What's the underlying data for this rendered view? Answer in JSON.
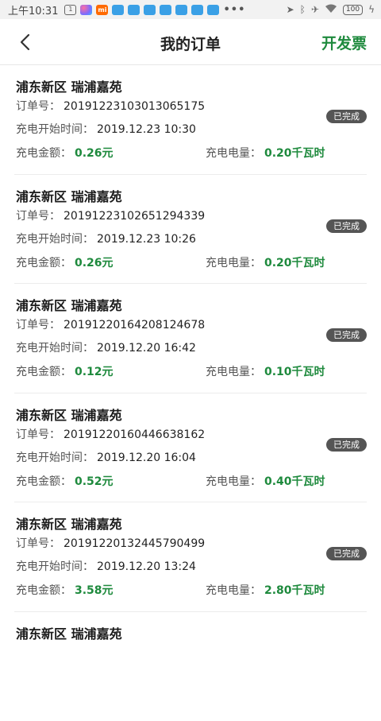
{
  "status_bar": {
    "time": "上午10:31",
    "notification_icons": [
      "box-icon",
      "colorful-app-icon",
      "mi-icon",
      "cloud-icon",
      "cloud-icon",
      "cloud-icon",
      "cloud-icon",
      "cloud-icon",
      "cloud-icon",
      "cloud-icon"
    ],
    "mi_label": "mi",
    "box_label": "1",
    "more": "•••",
    "battery": "100"
  },
  "header": {
    "title": "我的订单",
    "action_label": "开发票"
  },
  "labels": {
    "order_no": "订单号：",
    "start_time": "充电开始时间：",
    "amount": "充电金额：",
    "energy": "充电电量："
  },
  "orders": [
    {
      "station": "浦东新区 瑞浦嘉苑",
      "order_no": "20191223103013065175",
      "start_time": "2019.12.23 10:30",
      "amount": "0.26元",
      "energy": "0.20千瓦时",
      "status": "已完成"
    },
    {
      "station": "浦东新区 瑞浦嘉苑",
      "order_no": "20191223102651294339",
      "start_time": "2019.12.23 10:26",
      "amount": "0.26元",
      "energy": "0.20千瓦时",
      "status": "已完成"
    },
    {
      "station": "浦东新区 瑞浦嘉苑",
      "order_no": "20191220164208124678",
      "start_time": "2019.12.20 16:42",
      "amount": "0.12元",
      "energy": "0.10千瓦时",
      "status": "已完成"
    },
    {
      "station": "浦东新区 瑞浦嘉苑",
      "order_no": "20191220160446638162",
      "start_time": "2019.12.20 16:04",
      "amount": "0.52元",
      "energy": "0.40千瓦时",
      "status": "已完成"
    },
    {
      "station": "浦东新区 瑞浦嘉苑",
      "order_no": "20191220132445790499",
      "start_time": "2019.12.20 13:24",
      "amount": "3.58元",
      "energy": "2.80千瓦时",
      "status": "已完成"
    },
    {
      "station": "浦东新区 瑞浦嘉苑"
    }
  ],
  "colors": {
    "accent_green": "#1e8a3d",
    "badge_gray": "#555555"
  }
}
